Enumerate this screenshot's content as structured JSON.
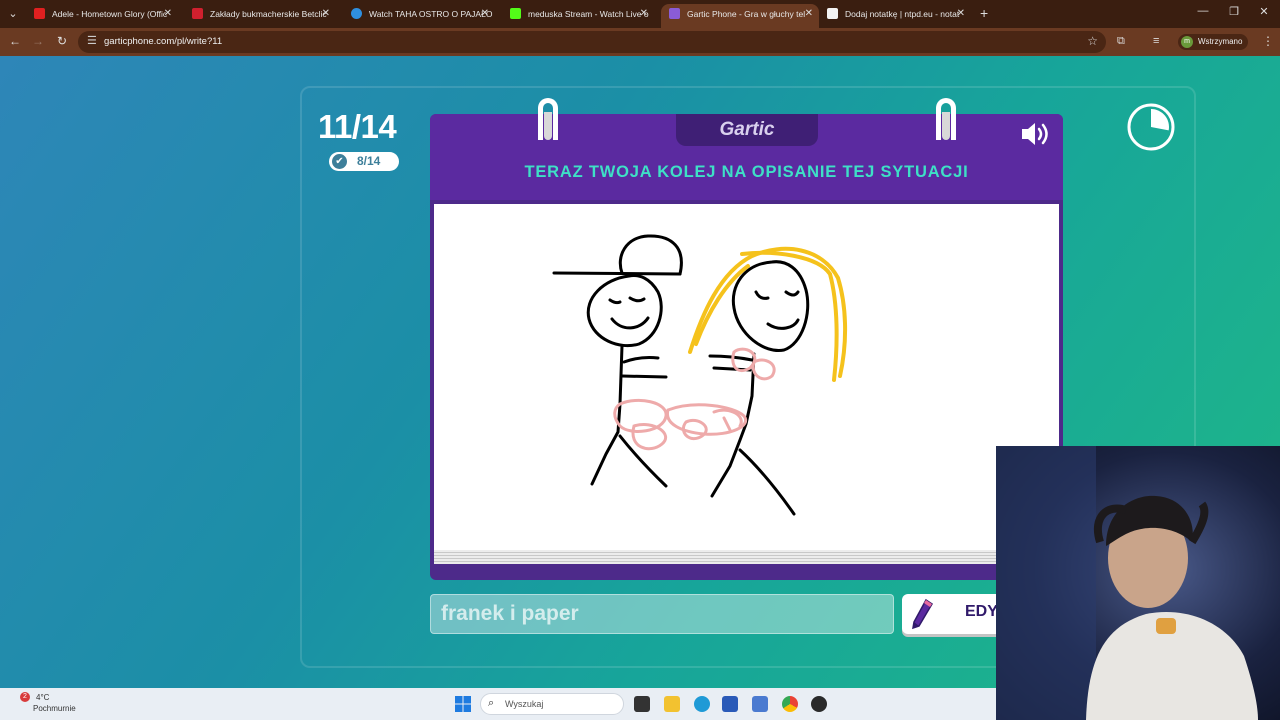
{
  "browser": {
    "tabs": [
      {
        "title": "Adele - Hometown Glory (Offic",
        "favicon_color": "#e02020",
        "active": false
      },
      {
        "title": "Zakłady bukmacherskie Betclic",
        "favicon_color": "#d0202e",
        "active": false
      },
      {
        "title": "Watch TAHA OSTRO O PAJAŁO",
        "favicon_color": "#2f8fe0",
        "active": false
      },
      {
        "title": "meduska Stream - Watch Live o",
        "favicon_color": "#53fc18",
        "active": false
      },
      {
        "title": "Gartic Phone - Gra w głuchy tel",
        "favicon_color": "#8a5cd6",
        "active": true
      },
      {
        "title": "Dodaj notatkę | ntpd.eu - notat",
        "favicon_color": "#f2f2f2",
        "active": false
      }
    ],
    "url": "garticphone.com/pl/write?11",
    "profile_label": "Wstrzymano",
    "profile_initial": "m"
  },
  "game": {
    "round_counter": "11/14",
    "players_done": "8/14",
    "logo_text": "Gartic",
    "prompt": "TERAZ TWOJA KOLEJ NA OPISANIE TEJ SYTUACJI",
    "answer_value": "franek i paper",
    "edit_button_label": "EDY",
    "timer_progress": 0.28
  },
  "taskbar": {
    "weather_temp": "4°C",
    "weather_text": "Pochmurnie",
    "weather_badge": "2",
    "search_placeholder": "Wyszukaj"
  },
  "icons": {
    "sound": "speaker-icon",
    "timer": "timer-icon",
    "edit": "pencil-icon",
    "done": "check-icon"
  }
}
